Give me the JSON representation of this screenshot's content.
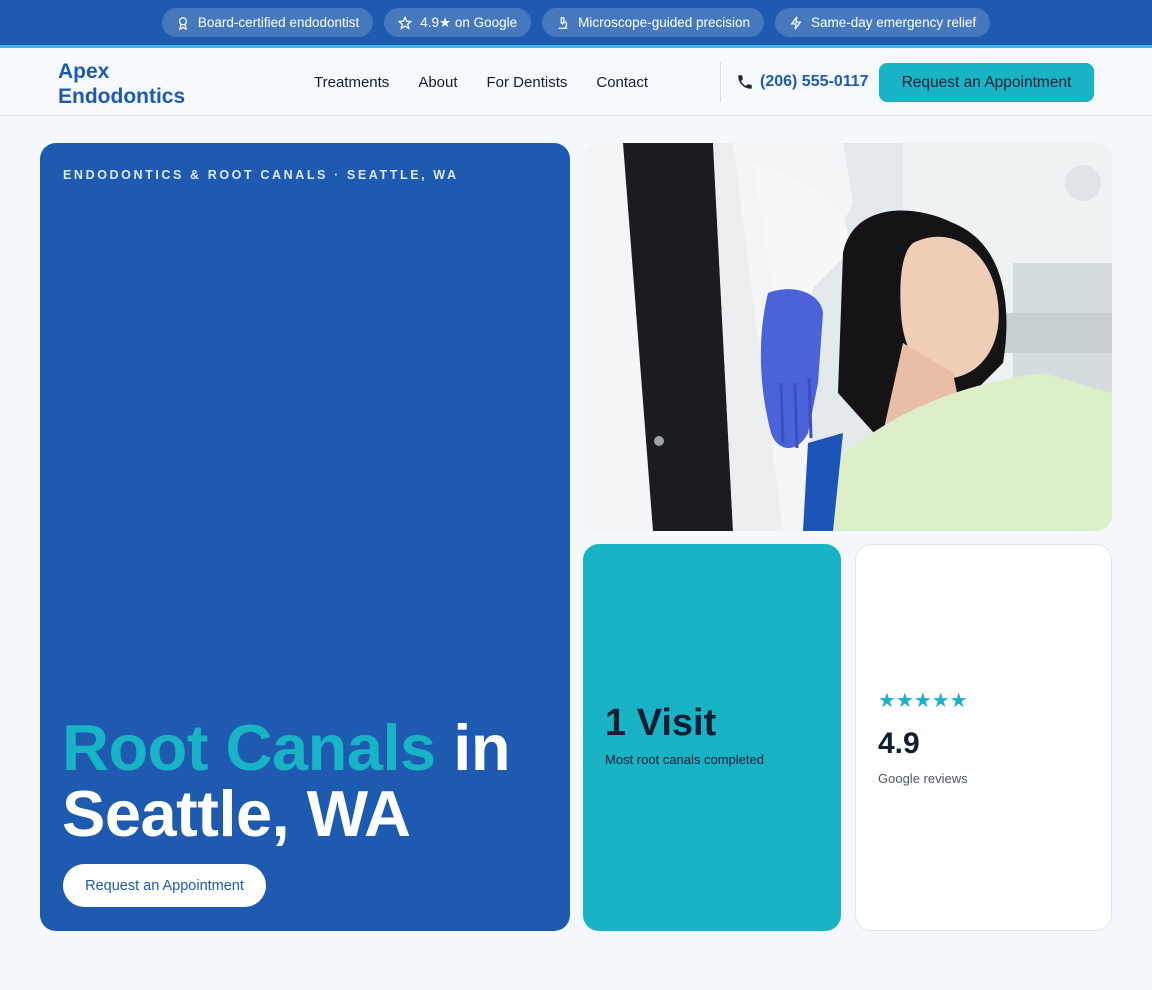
{
  "trustbar": {
    "items": [
      {
        "label": "Board-certified endodontist",
        "icon": "award-icon"
      },
      {
        "label": "4.9★ on Google",
        "icon": "star-outline-icon"
      },
      {
        "label": "Microscope-guided precision",
        "icon": "microscope-icon"
      },
      {
        "label": "Same-day emergency relief",
        "icon": "lightning-icon"
      }
    ]
  },
  "header": {
    "logo_line1": "Apex",
    "logo_line2": "Endodontics",
    "nav": [
      "Treatments",
      "About",
      "For Dentists",
      "Contact"
    ],
    "phone": "(206) 555-0117",
    "phone_icon": "phone-icon",
    "cta": "Request an Appointment"
  },
  "hero": {
    "eyebrow": "ENDODONTICS & ROOT CANALS · SEATTLE, WA",
    "headline_accent": "Root Canals",
    "headline_rest_1": " in",
    "headline_line2": "Seattle, WA",
    "cta": "Request an Appointment"
  },
  "stats": {
    "visits_value": "1 Visit",
    "visits_label": "Most root canals completed",
    "rating_stars": "★★★★★",
    "rating_value": "4.9",
    "rating_label": "Google reviews"
  },
  "colors": {
    "brand_blue": "#1e5bb0",
    "accent_teal": "#19b3c6",
    "dark_text": "#0f1f33"
  }
}
